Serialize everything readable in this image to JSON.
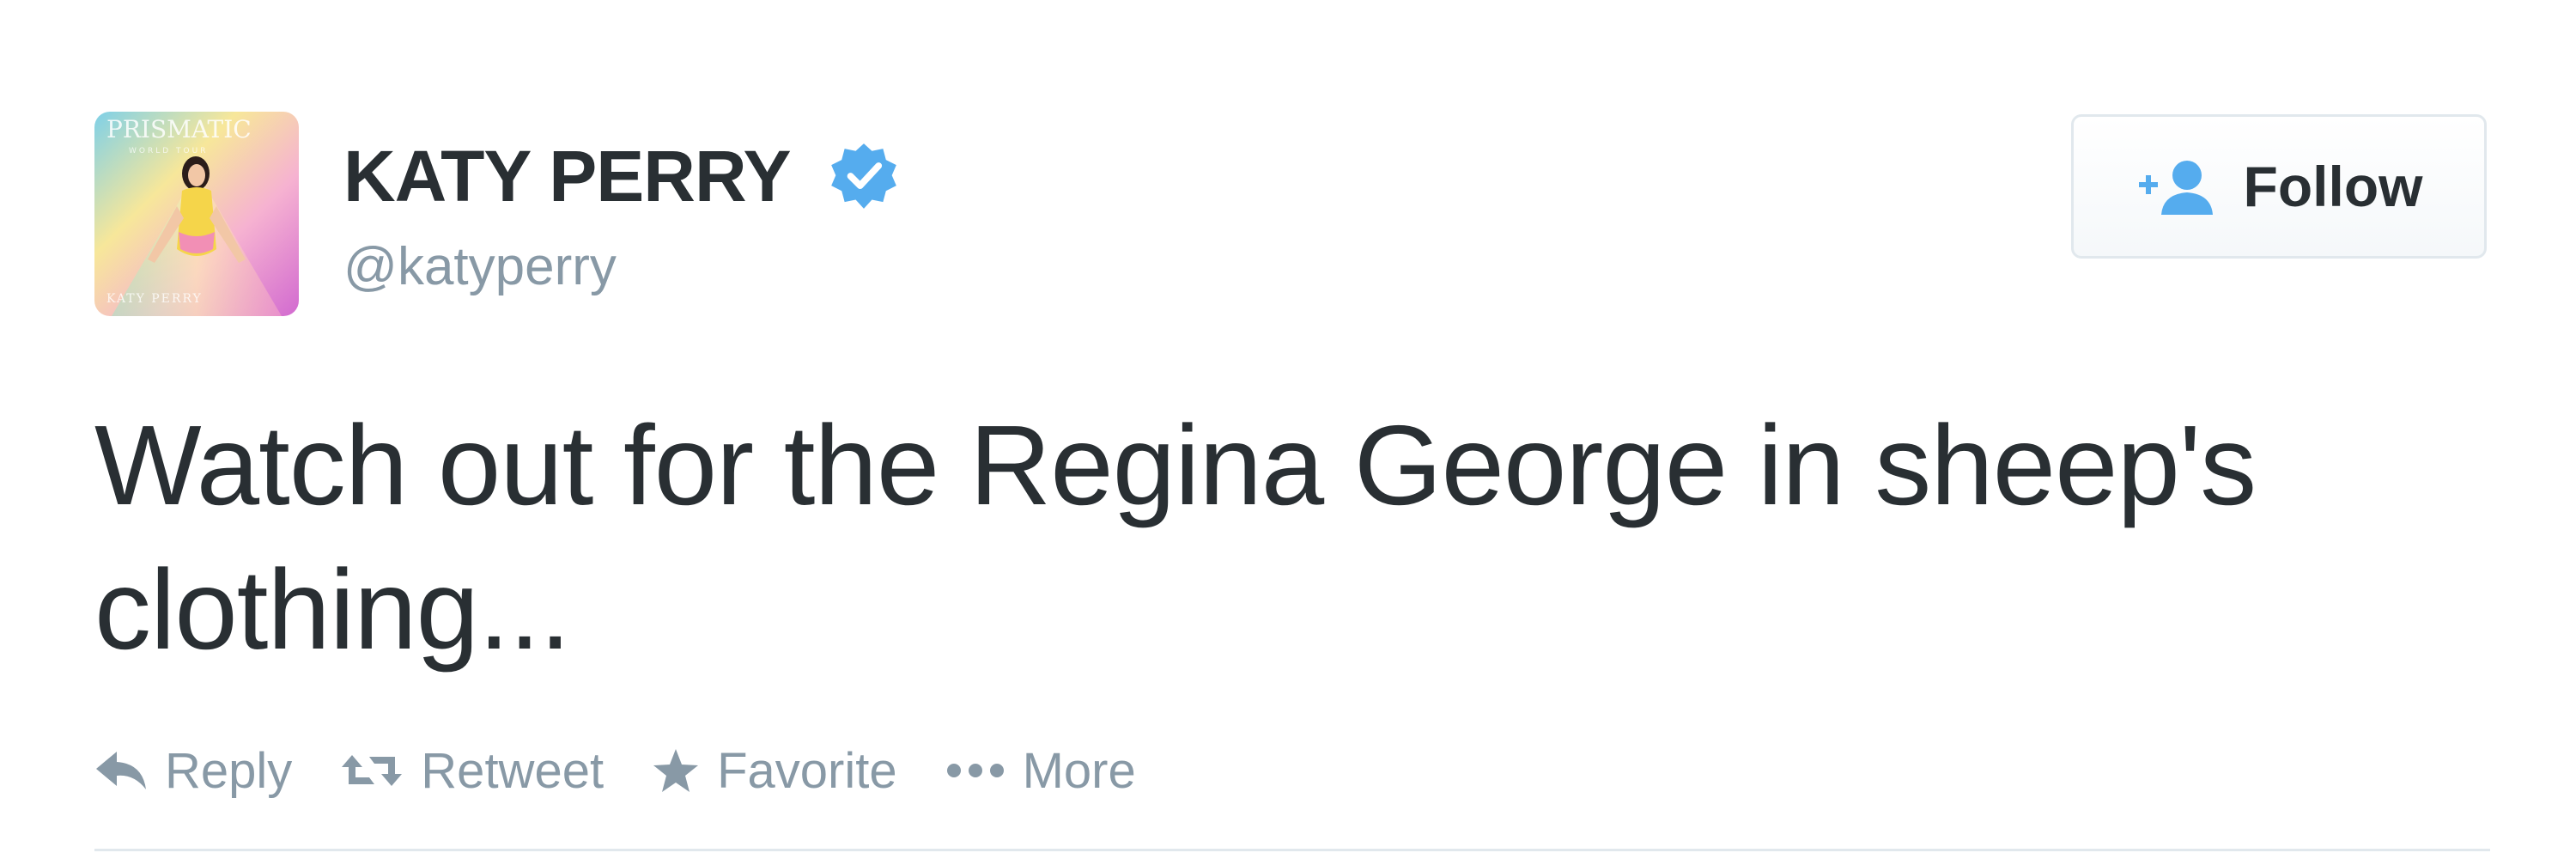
{
  "tweet": {
    "avatar": {
      "alt_icon": "prismatic-album-cover",
      "cover_title": "PRISMATIC",
      "cover_subtitle": "WORLD TOUR",
      "cover_artist": "KATY PERRY"
    },
    "author": {
      "display_name": "KATY PERRY",
      "handle": "@katyperry",
      "verified": true
    },
    "follow_button": {
      "icon": "add-user-icon",
      "label": "Follow"
    },
    "text_line_1": "Watch out for the Regina George in sheep's",
    "text_line_2": "clothing...",
    "actions": [
      {
        "icon": "reply-icon",
        "label": "Reply"
      },
      {
        "icon": "retweet-icon",
        "label": "Retweet"
      },
      {
        "icon": "star-icon",
        "label": "Favorite"
      },
      {
        "icon": "more-dots-icon",
        "label": "More"
      }
    ]
  },
  "colors": {
    "text": "#292f33",
    "muted": "#8899a6",
    "verified_blue": "#55acee",
    "border": "#e1e8ed"
  }
}
